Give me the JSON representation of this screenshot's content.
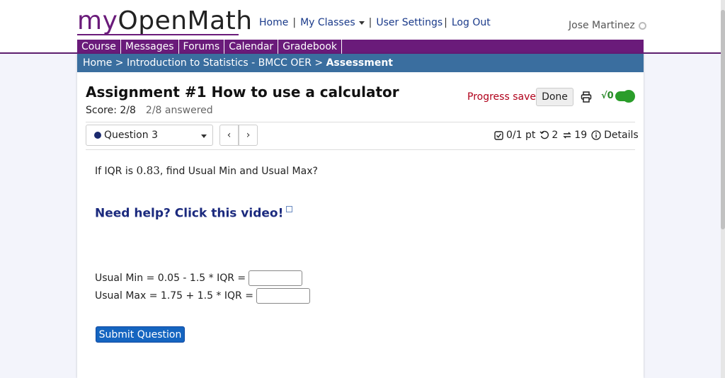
{
  "logo": {
    "my": "my",
    "open_math": "OpenMath"
  },
  "top_nav": {
    "home": "Home",
    "my_classes": "My Classes",
    "user_settings": "User Settings",
    "log_out": "Log Out"
  },
  "user": {
    "name": "Jose Martinez"
  },
  "course_nav": [
    {
      "label": "Course"
    },
    {
      "label": "Messages"
    },
    {
      "label": "Forums"
    },
    {
      "label": "Calendar"
    },
    {
      "label": "Gradebook"
    }
  ],
  "breadcrumb": {
    "home": "Home",
    "course": "Introduction to Statistics - BMCC OER",
    "current": "Assessment",
    "sep": ">"
  },
  "assessment": {
    "title": "Assignment #1 How to use a calculator",
    "score": "Score: 2/8",
    "answered": "2/8 answered",
    "progress_saved": "Progress saved",
    "done_label": "Done",
    "sqrt_label": "√0"
  },
  "question_bar": {
    "selected": "Question 3",
    "prev": "‹",
    "next": "›",
    "points": "0/1 pt",
    "retries": "2",
    "versions": "19",
    "details": "Details"
  },
  "question": {
    "text_before": "If IQR is ",
    "value": "0.83",
    "text_after": ", find Usual Min and Usual Max?",
    "help_link": "Need help? Click this video!",
    "min_label": "Usual Min = 0.05 - 1.5 * IQR =",
    "max_label": "Usual Max = 1.75 + 1.5 * IQR =",
    "min_value": "",
    "max_value": "",
    "submit_label": "Submit Question"
  },
  "colors": {
    "brand_purple": "#6a1b7a",
    "breadcrumb_blue": "#3a6e9f",
    "submit_blue": "#1565c0",
    "progress_red": "#b0001a",
    "toggle_green": "#2a9d2a"
  }
}
